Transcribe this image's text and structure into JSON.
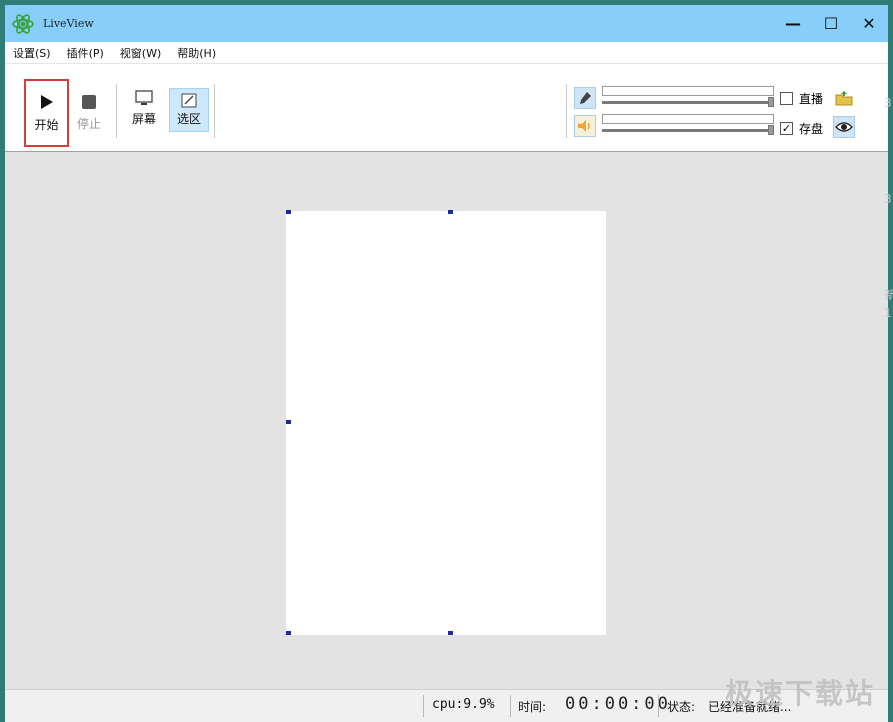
{
  "window": {
    "title": "LiveView",
    "controls": {
      "minimize": "—",
      "maximize": "☐",
      "close": "✕"
    }
  },
  "menu": [
    "设置(S)",
    "插件(P)",
    "视窗(W)",
    "帮助(H)"
  ],
  "toolbar": {
    "start_label": "开始",
    "stop_label": "停止",
    "screen_label": "屏幕",
    "region_label": "选区",
    "live_label": "直播",
    "live_checked": false,
    "save_label": "存盘",
    "save_checked": true
  },
  "status": {
    "cpu": "cpu:9.9%",
    "time_label": "时间:",
    "time_value": "00:00:00",
    "state_label": "状态:",
    "state_value": "已经准备就绪..."
  },
  "watermark": "极速下载站",
  "edge_chars": [
    "3",
    "3",
    "新",
    "1"
  ],
  "colors": {
    "titlebar": "#87cefa",
    "window_border": "#2e7d76",
    "start_highlight": "#d33f3f",
    "region_selected": "#cde8fb",
    "handle": "#1c2a9a"
  }
}
